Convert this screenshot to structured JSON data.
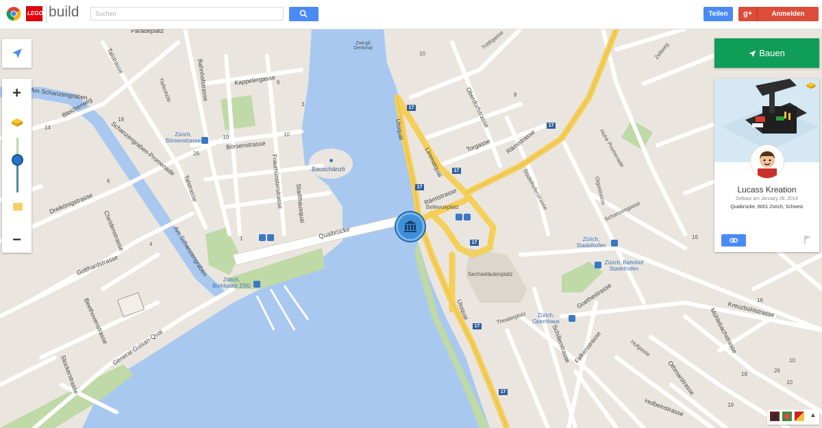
{
  "header": {
    "brand_word": "build",
    "lego_logo_text": "LEGO",
    "search_placeholder": "Suchen",
    "share_label": "Teilen",
    "signin_label": "Anmelden",
    "gplus_label": "g+"
  },
  "controls": {
    "zoom_in": "+",
    "zoom_out": "−",
    "build_button": "Bauen"
  },
  "creation_card": {
    "title": "Lucass Kreation",
    "built_date": "Gebaut am January 28, 2014",
    "address": "Quaibrücke, 8001 Zürich, Schweiz"
  },
  "map": {
    "water_labels": [
      "Bauschänzli",
      "Zwingli Denkmal"
    ],
    "street_labels": [
      "Paradeplatz",
      "Talstrasse",
      "Am Schanzengraben",
      "Bleicherweg",
      "Schanzengraben-Promenade",
      "Am Schanzengraben",
      "Dreikönigstrasse",
      "Claridenstrasse",
      "Gotthardstrasse",
      "Beethovenstrasse",
      "General-Guisan-Quai",
      "Stockerstrasse",
      "Tiefenhöfe",
      "Bahnhofstrasse",
      "Kappelergasse",
      "Börsenstrasse",
      "Fraumünsterstrasse",
      "Stadthausquai",
      "Talstrasse",
      "Quaibrücke",
      "Utoquai",
      "Limmatquai",
      "Rämistrasse",
      "Oberdorfstrasse",
      "Torgasse",
      "Rämistrasse",
      "Bellevueplatz",
      "Sechseläutenplatz",
      "Theaterplatz",
      "Utoquai",
      "Goethestrasse",
      "Schillerstrasse",
      "Falkenstrasse",
      "Kreuzbühlstrasse",
      "Hufgasse",
      "Mühlebachstrasse",
      "Othmarstrasse",
      "Holbeinstrasse",
      "Hohe Promenade",
      "Olgastrasse",
      "Schanzengasse",
      "Zeltweg",
      "Stadelhoferstrasse",
      "Trittligasse"
    ],
    "transit_labels": [
      "Zürich, Börsenstrasse",
      "Zürich, Bürkliplatz ZSG",
      "Zürich, Stadelhofen",
      "Zürich, Bahnhof Stadelhofen",
      "Zürich, Opernhaus"
    ],
    "route_number": "17",
    "house_numbers": [
      "14",
      "18",
      "10",
      "10",
      "26",
      "3",
      "1",
      "4",
      "6",
      "6",
      "8",
      "10",
      "10",
      "18",
      "19",
      "16",
      "16",
      "10",
      "26"
    ]
  },
  "colors": {
    "water": "#a8c8f0",
    "land": "#eae6df",
    "road": "#ffffff",
    "major_road": "#f4cf5a",
    "park": "#bfd9a7",
    "accent_blue": "#4a8af4",
    "build_green": "#0f9d58",
    "signin_red": "#dd4b39"
  },
  "icons": {
    "search": "search-icon",
    "locate": "navigation-arrow-icon",
    "brick": "lego-brick-icon",
    "flat_brick": "lego-plate-icon",
    "link": "link-icon",
    "flag": "flag-icon",
    "landmark": "museum-icon"
  }
}
